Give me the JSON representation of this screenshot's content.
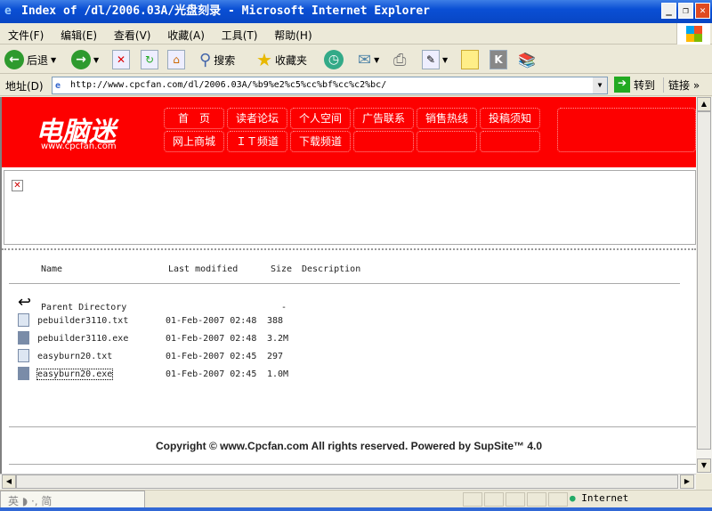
{
  "window": {
    "title": "Index of /dl/2006.03A/光盘刻录 - Microsoft Internet Explorer"
  },
  "menu": [
    "文件(F)",
    "编辑(E)",
    "查看(V)",
    "收藏(A)",
    "工具(T)",
    "帮助(H)"
  ],
  "toolbar": {
    "back": "后退",
    "search": "搜索",
    "favorites": "收藏夹"
  },
  "address": {
    "label": "地址(D)",
    "url": "http://www.cpcfan.com/dl/2006.03A/%b9%e2%c5%cc%bf%cc%c2%bc/",
    "go": "转到",
    "links": "链接"
  },
  "site": {
    "logo": "电脑迷",
    "logo_url": "www.cpcfan.com",
    "nav_row1": [
      "首　页",
      "读者论坛",
      "个人空间",
      "广告联系",
      "销售热线",
      "投稿须知"
    ],
    "nav_row2": [
      "网上商城",
      "ＩＴ频道",
      "下载频道"
    ]
  },
  "listing": {
    "headers": {
      "name": "Name",
      "modified": "Last modified",
      "size": "Size",
      "description": "Description"
    },
    "parent": {
      "name": "Parent Directory",
      "size": "-"
    },
    "files": [
      {
        "name": "pebuilder3110.txt",
        "modified": "01-Feb-2007 02:48",
        "size": "388",
        "type": "txt"
      },
      {
        "name": "pebuilder3110.exe",
        "modified": "01-Feb-2007 02:48",
        "size": "3.2M",
        "type": "exe"
      },
      {
        "name": "easyburn20.txt",
        "modified": "01-Feb-2007 02:45",
        "size": "297",
        "type": "txt"
      },
      {
        "name": "easyburn20.exe",
        "modified": "01-Feb-2007 02:45",
        "size": "1.0M",
        "type": "exe"
      }
    ]
  },
  "footer": {
    "copyright": "Copyright ©  www.Cpcfan.com  All rights reserved. Powered by SupSite™ 4.0"
  },
  "status": {
    "ime": "英 ◗ ·, 简",
    "zone": "Internet"
  }
}
